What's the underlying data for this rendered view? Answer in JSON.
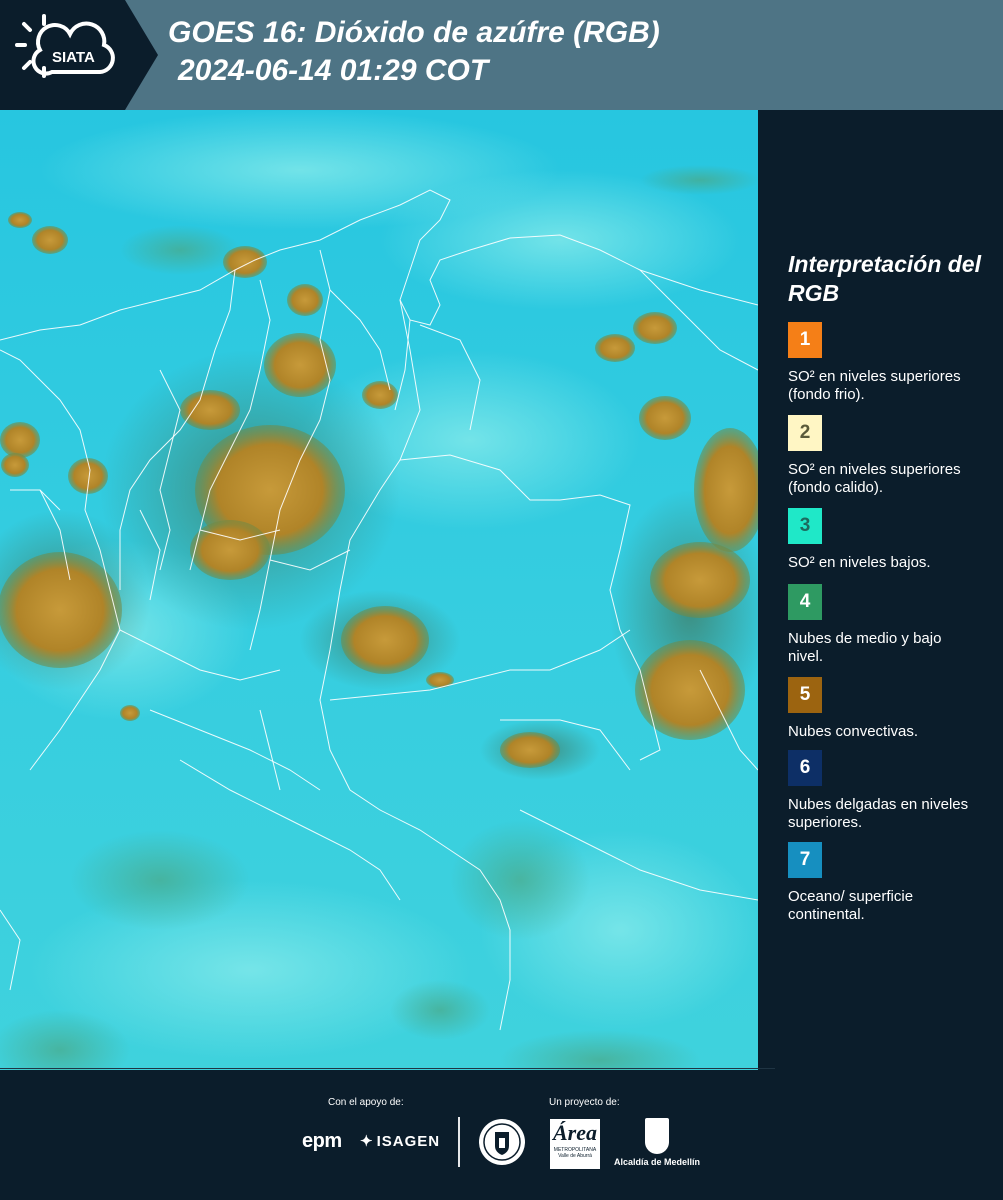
{
  "header": {
    "logo_text": "SIATA",
    "title_line1": "GOES 16: Dióxido de azúfre (RGB)",
    "title_line2": "2024-06-14 01:29 COT",
    "background_color": "#4e7485"
  },
  "legend": {
    "title": "Interpretación del RGB",
    "items": [
      {
        "number": "1",
        "color": "#f57f17",
        "text_color": "#ffffff",
        "label": "SO² en niveles superiores (fondo frio)."
      },
      {
        "number": "2",
        "color": "#fff6c4",
        "text_color": "#5a5a3a",
        "label": "SO² en niveles superiores (fondo calido)."
      },
      {
        "number": "3",
        "color": "#1fe8c8",
        "text_color": "#1d6a5e",
        "label": "SO² en niveles bajos."
      },
      {
        "number": "4",
        "color": "#2e9a62",
        "text_color": "#ffffff",
        "label": "Nubes de medio y bajo nivel."
      },
      {
        "number": "5",
        "color": "#9c6410",
        "text_color": "#ffffff",
        "label": "Nubes convectivas."
      },
      {
        "number": "6",
        "color": "#0d2f66",
        "text_color": "#ffffff",
        "label": "Nubes delgadas en niveles superiores."
      },
      {
        "number": "7",
        "color": "#168fc0",
        "text_color": "#ffffff",
        "label": "Oceano/ superficie continental."
      }
    ]
  },
  "footer": {
    "support_label": "Con el apoyo de:",
    "project_label": "Un proyecto de:",
    "epm_logo": "epm",
    "isagen_logo": "ISAGEN",
    "area_logo": "Área",
    "area_logo_sub": "METROPOLITANA Valle de Aburrá",
    "alcaldia_name": "Alcaldía de Medellín"
  },
  "map": {
    "ocean_color": "#27c6e0",
    "land_color": "#3fd2dd",
    "convective_cloud_color": "#b8892a",
    "boundary_color": "#ffffff"
  }
}
